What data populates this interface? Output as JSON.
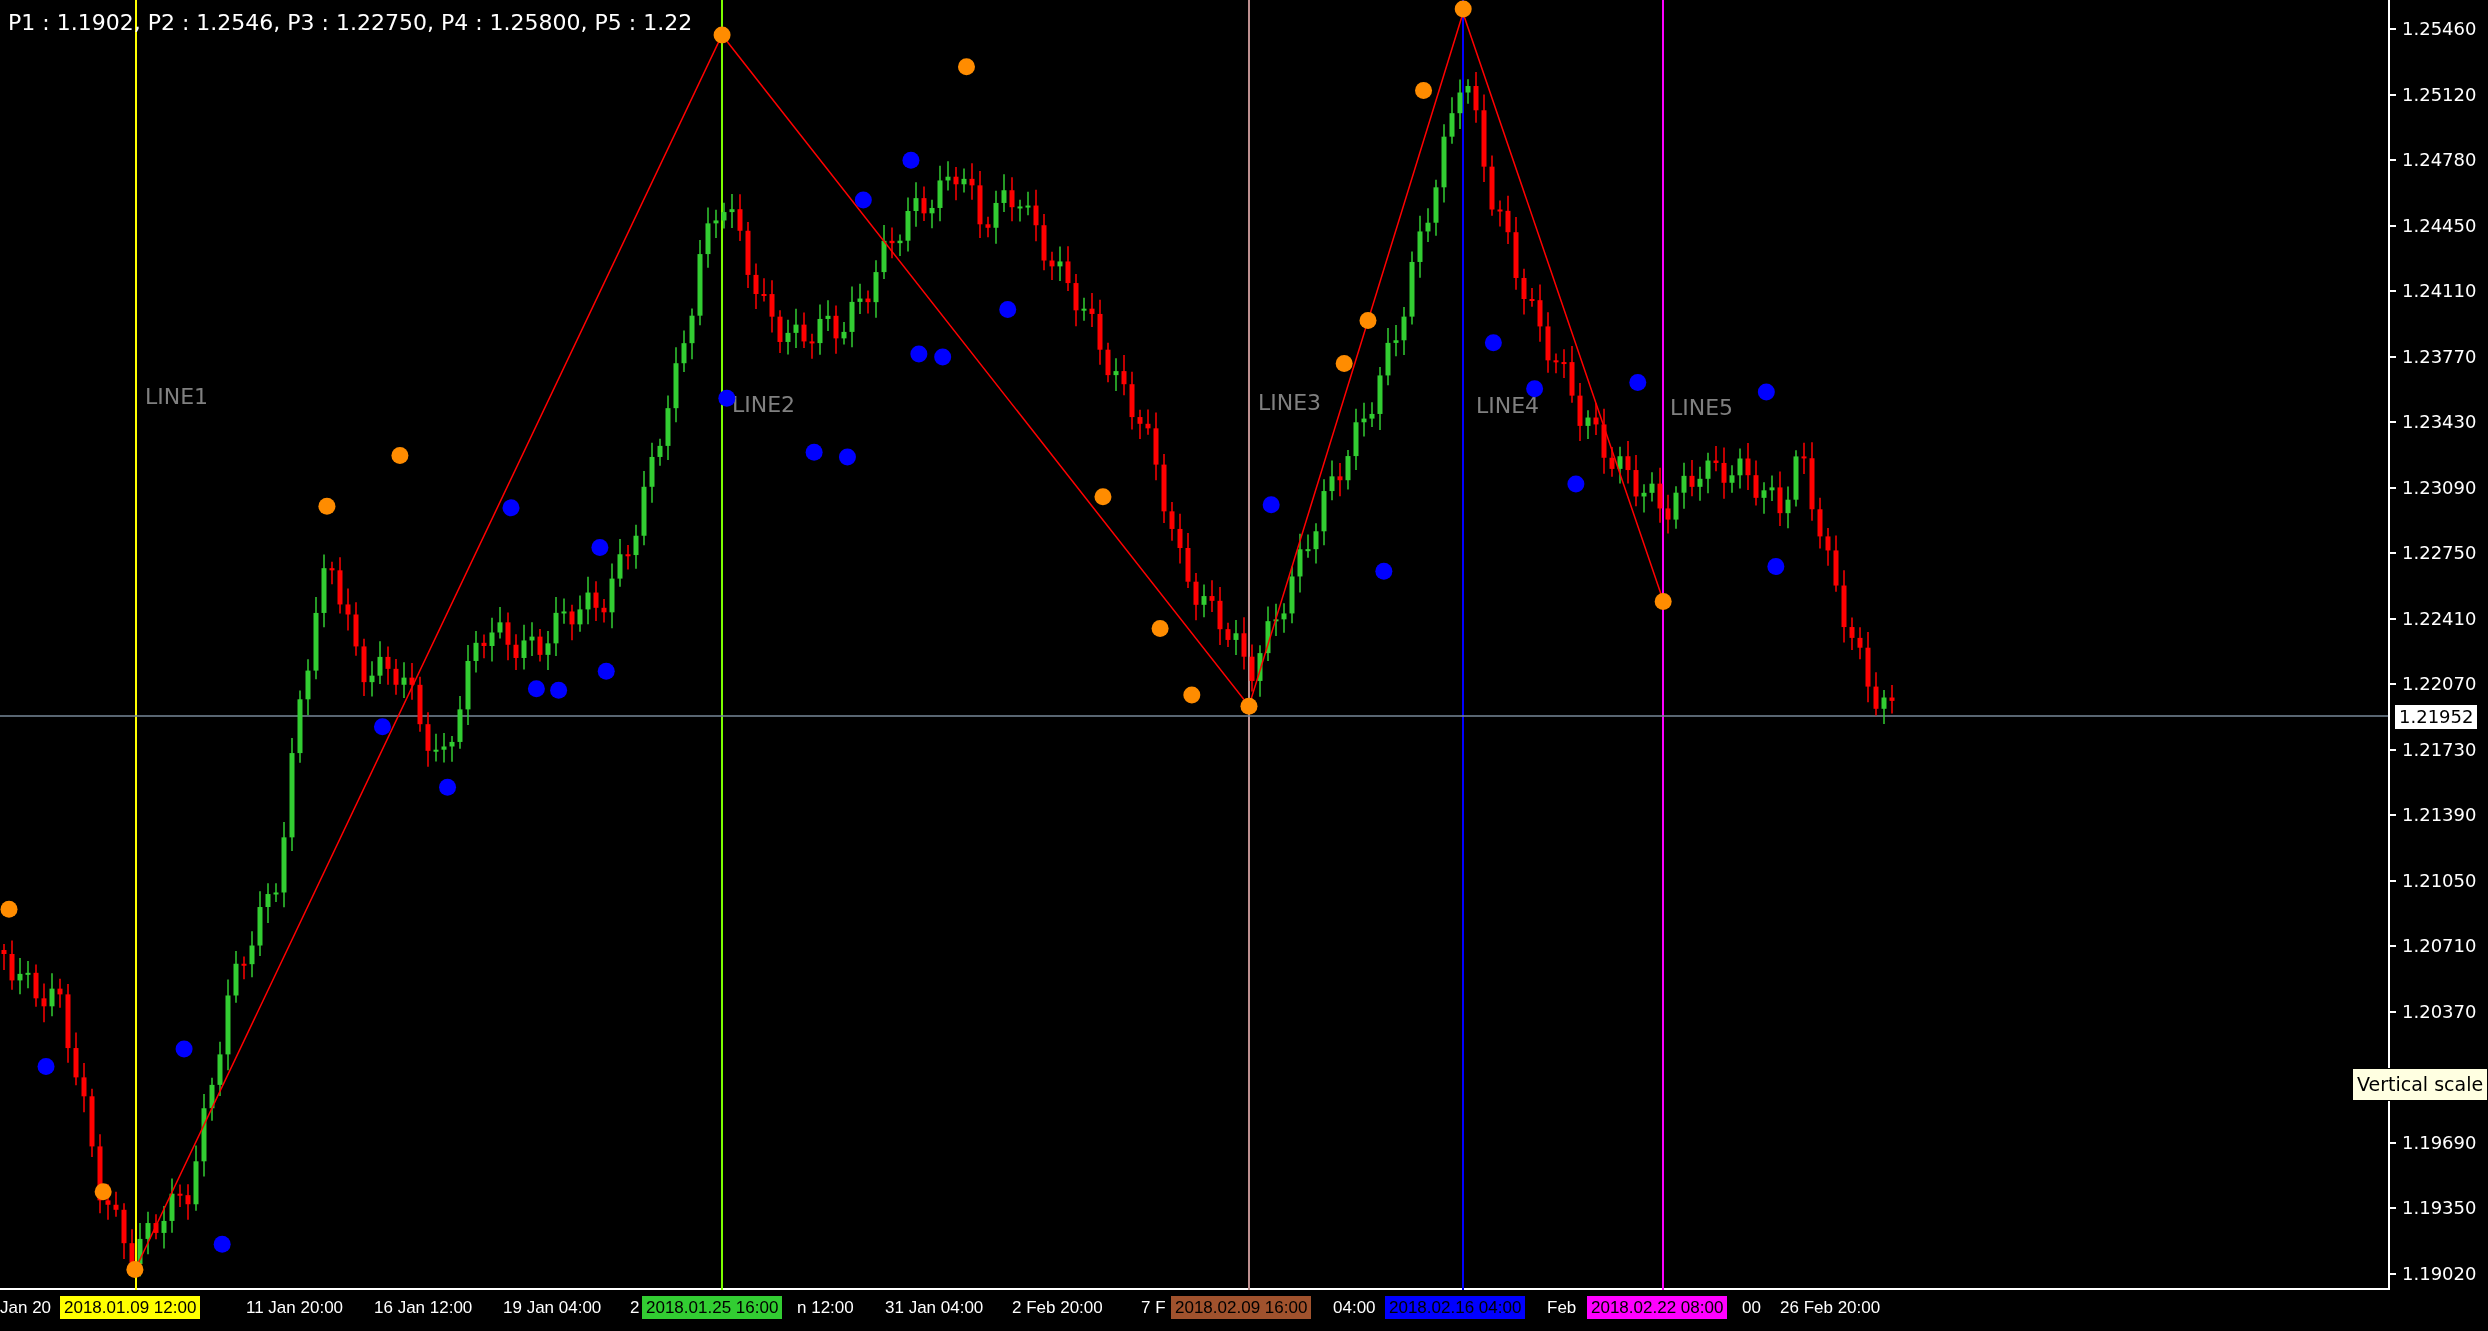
{
  "header": "P1 : 1.1902, P2 : 1.2546, P3 : 1.22750, P4 : 1.25800, P5 : 1.22",
  "lines": [
    {
      "label": "LINE1",
      "color": "#ffff00"
    },
    {
      "label": "LINE2",
      "color": "#7cfc00"
    },
    {
      "label": "LINE3",
      "color": "#bc8f8f"
    },
    {
      "label": "LINE4",
      "color": "#0000ff"
    },
    {
      "label": "LINE5",
      "color": "#ff00ff"
    }
  ],
  "price_scale": {
    "labels": [
      "1.25460",
      "1.25120",
      "1.24780",
      "1.24450",
      "1.24110",
      "1.23770",
      "1.23430",
      "1.23090",
      "1.22750",
      "1.22410",
      "1.22070",
      "1.21730",
      "1.21390",
      "1.21050",
      "1.20710",
      "1.20370",
      "1.19690",
      "1.19350",
      "1.19020"
    ],
    "current_price": "1.21952"
  },
  "time_axis": {
    "items": [
      {
        "kind": "label",
        "text": "Jan 20"
      },
      {
        "kind": "marker",
        "text": "2018.01.09 12:00",
        "color": "#ffff00"
      },
      {
        "kind": "label",
        "text": "11 Jan 20:00"
      },
      {
        "kind": "label",
        "text": "16 Jan 12:00"
      },
      {
        "kind": "label",
        "text": "19 Jan 04:00"
      },
      {
        "kind": "label",
        "text": "2"
      },
      {
        "kind": "marker",
        "text": "2018.01.25 16:00",
        "color": "#32cd32"
      },
      {
        "kind": "label",
        "text": "n 12:00"
      },
      {
        "kind": "label",
        "text": "31 Jan 04:00"
      },
      {
        "kind": "label",
        "text": "2 Feb 20:00"
      },
      {
        "kind": "label",
        "text": "7 F"
      },
      {
        "kind": "marker",
        "text": "2018.02.09 16:00",
        "color": "#a0522d"
      },
      {
        "kind": "label",
        "text": "04:00"
      },
      {
        "kind": "marker",
        "text": "2018.02.16 04:00",
        "color": "#0000ff"
      },
      {
        "kind": "label",
        "text": "Feb"
      },
      {
        "kind": "marker",
        "text": "2018.02.22 08:00",
        "color": "#ff00ff"
      },
      {
        "kind": "label",
        "text": "00"
      },
      {
        "kind": "label",
        "text": "26 Feb 20:00"
      }
    ]
  },
  "tooltip": "Vertical scale"
}
